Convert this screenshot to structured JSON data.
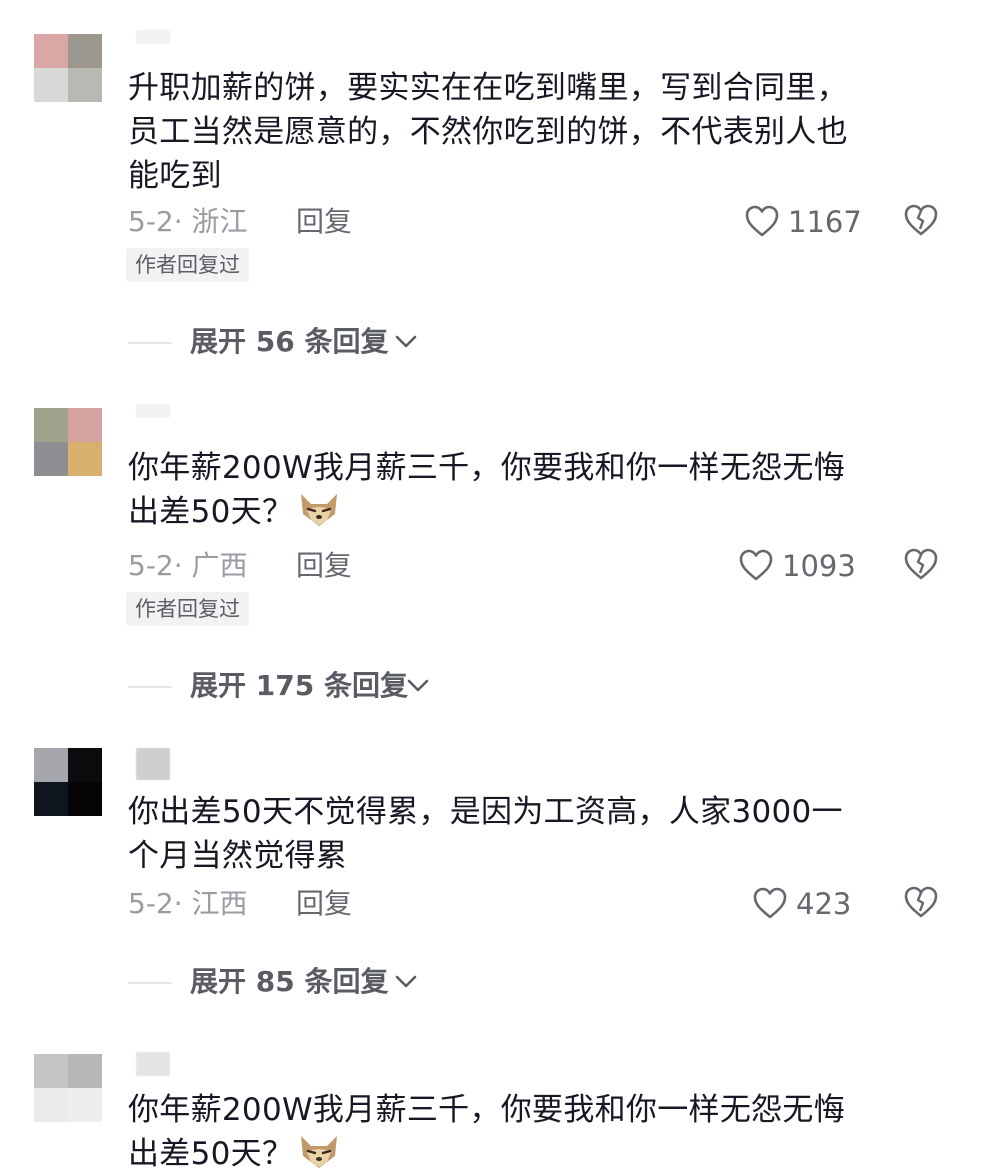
{
  "comments": [
    {
      "text": "升职加薪的饼，要实实在在吃到嘴里，写到合同里，\n员工当然是愿意的，不然你吃到的饼，不代表别人也\n能吃到",
      "date_location": "5-2· 浙江",
      "reply_label": "回复",
      "likes": "1167",
      "badge": "作者回复过",
      "expand_label": "展开 56 条回复"
    },
    {
      "text": "你年薪200W我月薪三千，你要我和你一样无怨无悔\n出差50天？",
      "emoji": "wolf-face-emoji",
      "date_location": "5-2· 广西",
      "reply_label": "回复",
      "likes": "1093",
      "badge": "作者回复过",
      "expand_label": "展开 175 条回复"
    },
    {
      "text": "你出差50天不觉得累，是因为工资高，人家3000一\n个月当然觉得累",
      "date_location": "5-2· 江西",
      "reply_label": "回复",
      "likes": "423",
      "expand_label": "展开 85 条回复"
    },
    {
      "text": "你年薪200W我月薪三千，你要我和你一样无怨无悔\n出差50天？",
      "emoji": "wolf-face-emoji"
    }
  ],
  "icons": {
    "like": "heart-outline-icon",
    "dislike": "broken-heart-icon",
    "expand": "chevron-down-icon"
  },
  "colors": {
    "text": "#161823",
    "meta": "#9a9ca3",
    "secondary": "#66686f"
  }
}
